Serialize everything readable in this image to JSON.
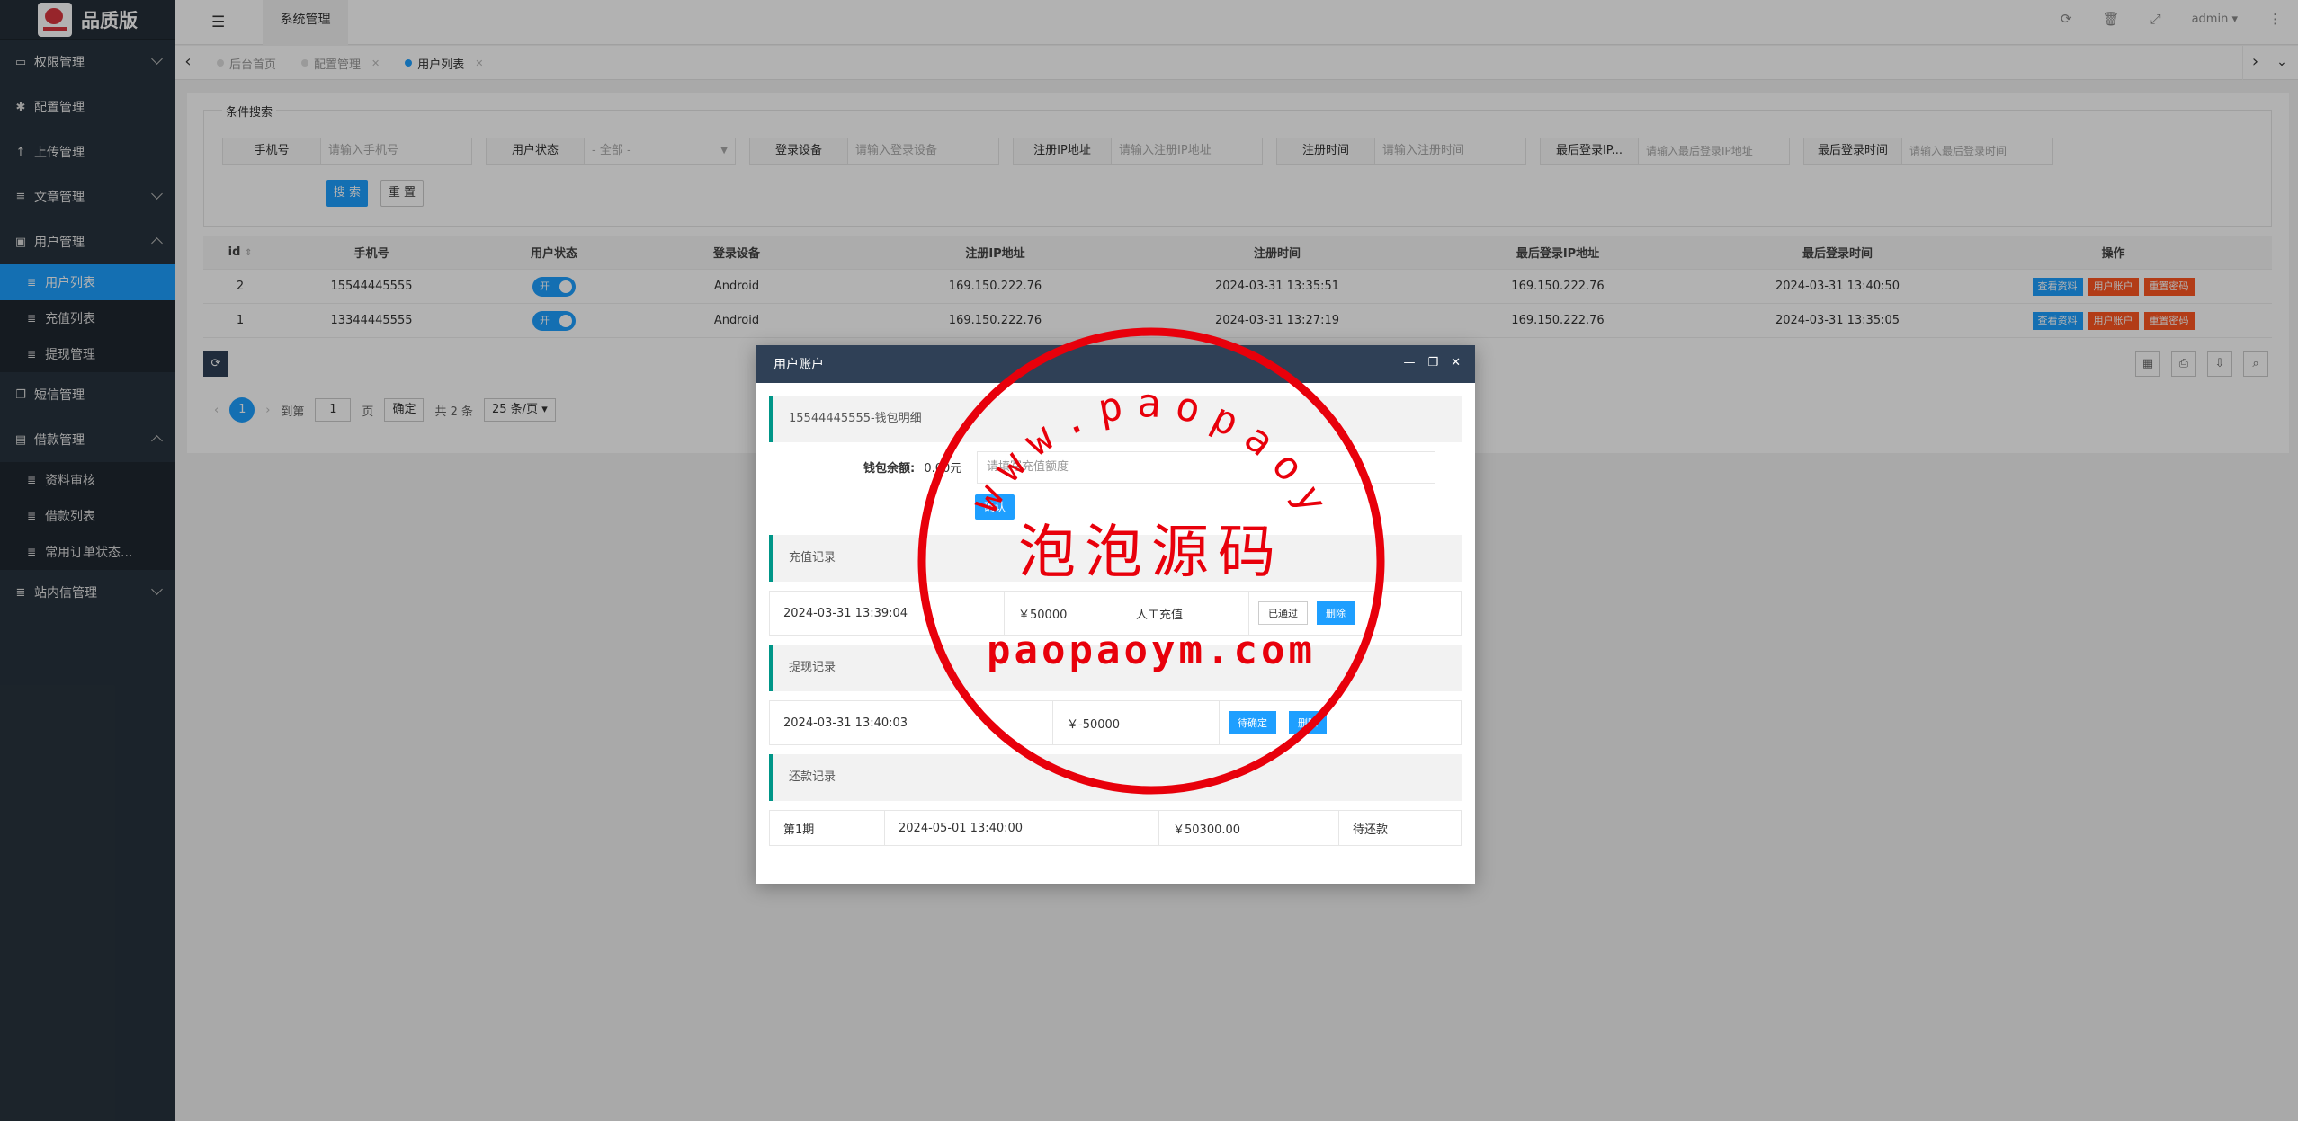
{
  "brand": {
    "title": "品质版"
  },
  "sidebar": {
    "items": [
      {
        "label": "权限管理",
        "icon": "monitor-icon"
      },
      {
        "label": "配置管理",
        "icon": "gear-icon"
      },
      {
        "label": "上传管理",
        "icon": "arrow-up-icon"
      },
      {
        "label": "文章管理",
        "icon": "list-icon"
      },
      {
        "label": "用户管理",
        "icon": "user-icon"
      },
      {
        "label": "短信管理",
        "icon": "copy-icon"
      },
      {
        "label": "借款管理",
        "icon": "money-icon"
      },
      {
        "label": "站内信管理",
        "icon": "list-icon"
      }
    ],
    "user_sub": [
      "用户列表",
      "充值列表",
      "提现管理"
    ],
    "loan_sub": [
      "资料审核",
      "借款列表",
      "常用订单状态..."
    ]
  },
  "topbar": {
    "tab": "系统管理",
    "user": "admin"
  },
  "tabs": [
    {
      "label": "后台首页"
    },
    {
      "label": "配置管理"
    },
    {
      "label": "用户列表"
    }
  ],
  "search": {
    "legend": "条件搜索",
    "fields": [
      {
        "label": "手机号",
        "placeholder": "请输入手机号"
      },
      {
        "label": "用户状态",
        "placeholder": "- 全部 -"
      },
      {
        "label": "登录设备",
        "placeholder": "请输入登录设备"
      },
      {
        "label": "注册IP地址",
        "placeholder": "请输入注册IP地址"
      },
      {
        "label": "注册时间",
        "placeholder": "请输入注册时间"
      },
      {
        "label": "最后登录IP...",
        "placeholder": "请输入最后登录IP地址"
      },
      {
        "label": "最后登录时间",
        "placeholder": "请输入最后登录时间"
      }
    ],
    "search_btn": "搜 索",
    "reset_btn": "重 置"
  },
  "table": {
    "headers": [
      "id",
      "手机号",
      "用户状态",
      "登录设备",
      "注册IP地址",
      "注册时间",
      "最后登录IP地址",
      "最后登录时间",
      "操作"
    ],
    "rows": [
      {
        "id": "2",
        "phone": "15544445555",
        "status": "开",
        "device": "Android",
        "reg_ip": "169.150.222.76",
        "reg_time": "2024-03-31 13:35:51",
        "last_ip": "169.150.222.76",
        "last_time": "2024-03-31 13:40:50"
      },
      {
        "id": "1",
        "phone": "13344445555",
        "status": "开",
        "device": "Android",
        "reg_ip": "169.150.222.76",
        "reg_time": "2024-03-31 13:27:19",
        "last_ip": "169.150.222.76",
        "last_time": "2024-03-31 13:35:05"
      }
    ],
    "ops": [
      "查看资料",
      "用户账户",
      "重置密码"
    ]
  },
  "pager": {
    "current": "1",
    "goto": "到第",
    "page_val": "1",
    "page_unit": "页",
    "confirm": "确定",
    "total": "共 2 条",
    "size": "25 条/页"
  },
  "modal": {
    "title": "用户账户",
    "wallet_title": "15544445555-钱包明细",
    "balance_label": "钱包余额:",
    "balance_value": "0.00元",
    "amount_placeholder": "请填写充值额度",
    "confirm": "确认",
    "recharge_title": "充值记录",
    "recharge": {
      "time": "2024-03-31 13:39:04",
      "amount": "￥50000",
      "type": "人工充值",
      "status": "已通过",
      "delete": "删除"
    },
    "withdraw_title": "提现记录",
    "withdraw": {
      "time": "2024-03-31 13:40:03",
      "amount": "￥-50000",
      "status": "待确定",
      "delete": "删除"
    },
    "repay_title": "还款记录",
    "repay": {
      "period": "第1期",
      "time": "2024-05-01 13:40:00",
      "amount": "￥50300.00",
      "status": "待还款"
    }
  },
  "stamp": {
    "arc_text": "www.paopaoym.com",
    "center": "泡泡源码",
    "bottom": "paopaoym.com",
    "color": "#e8000b"
  }
}
